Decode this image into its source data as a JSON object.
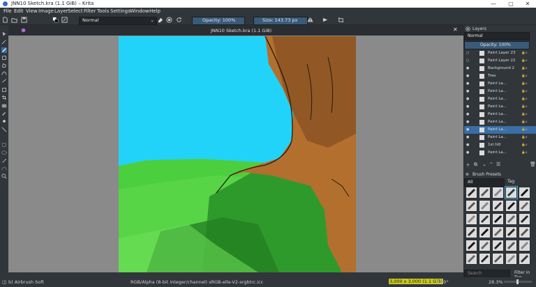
{
  "window": {
    "title": "JNN10 Sketch.kra (1.1 GiB) – Krita",
    "minimize": "—",
    "maximize": "▢",
    "close": "✕"
  },
  "menu": [
    "File",
    "Edit",
    "View",
    "Image",
    "Layer",
    "Select",
    "Filter",
    "Tools",
    "Settings",
    "Window",
    "Help"
  ],
  "toolbar": {
    "blend_mode": "Normal",
    "opacity": "Opacity: 100%",
    "size": "Size: 143.73 px"
  },
  "document": {
    "tab_title": "JNN10 Sketch.kra (1.1 GiB)",
    "close": "✕"
  },
  "layers_panel": {
    "title": "Layers",
    "blend_mode": "Normal",
    "opacity": "Opacity: 100%",
    "layers": [
      {
        "name": "Paint Layer 23",
        "visible": false
      },
      {
        "name": "Paint Layer 22",
        "visible": false
      },
      {
        "name": "Background 2",
        "visible": true
      },
      {
        "name": "Tree",
        "visible": true
      },
      {
        "name": "Paint La...",
        "visible": true
      },
      {
        "name": "Paint La...",
        "visible": true
      },
      {
        "name": "Paint La...",
        "visible": true
      },
      {
        "name": "Paint La...",
        "visible": true
      },
      {
        "name": "Paint La...",
        "visible": true
      },
      {
        "name": "Paint La...",
        "visible": true
      },
      {
        "name": "Paint La...",
        "visible": true,
        "selected": true
      },
      {
        "name": "Paint La...",
        "visible": true
      },
      {
        "name": "1st hill",
        "visible": true
      },
      {
        "name": "Paint La...",
        "visible": true
      }
    ]
  },
  "brush_presets": {
    "title": "Brush Presets",
    "filter": "All",
    "tag": "Tag",
    "search_placeholder": "Search",
    "filter_in_tag": "Filter in Tag"
  },
  "status": {
    "brush": "b) Airbrush Soft",
    "color_info": "RGB/Alpha (8-bit integer/channel)  sRGB-elle-V2-srgbtrc.icc",
    "dimensions": "3,000 x 3,000 (1.1 GiB)",
    "rotation": "0.00°",
    "zoom": "28.3%"
  },
  "colors": {
    "accent": "#3daee9",
    "background": "#31363b",
    "sky": "#22d3f9",
    "grass": "#4ccf3e",
    "trunk": "#b36f2e"
  }
}
